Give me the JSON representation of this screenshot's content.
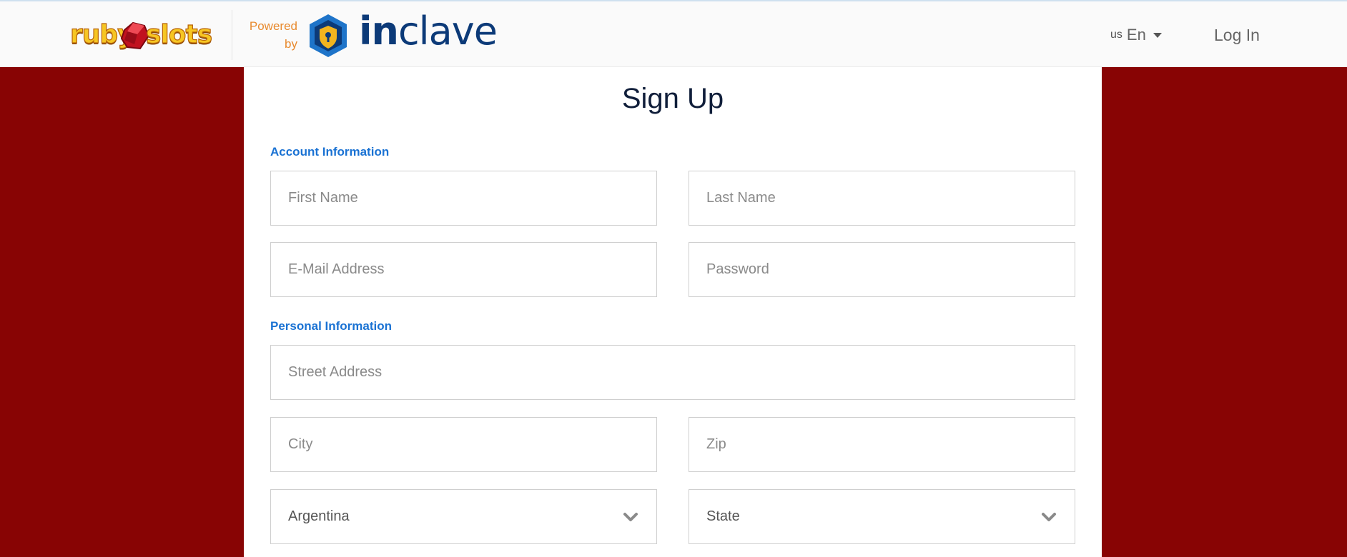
{
  "header": {
    "brand_logo_text": "ruby slots",
    "powered_by": "Powered by",
    "partner_logo_text": {
      "bold": "in",
      "rest": "clave"
    },
    "language": {
      "flag": "us",
      "label": "En"
    },
    "login_label": "Log In"
  },
  "form": {
    "title": "Sign Up",
    "account_section": "Account Information",
    "personal_section": "Personal Information",
    "first_name_placeholder": "First Name",
    "last_name_placeholder": "Last Name",
    "email_placeholder": "E-Mail Address",
    "password_placeholder": "Password",
    "street_placeholder": "Street Address",
    "city_placeholder": "City",
    "zip_placeholder": "Zip",
    "country_selected": "Argentina",
    "state_selected": "State"
  },
  "colors": {
    "background": "#880404",
    "section_heading": "#1a72d3",
    "title": "#101e3a",
    "powered_by": "#e88a2e",
    "partner_brand": "#0c3a78"
  },
  "icons": {
    "dropdown": "chevron-down-icon",
    "language_caret": "caret-down-icon"
  }
}
